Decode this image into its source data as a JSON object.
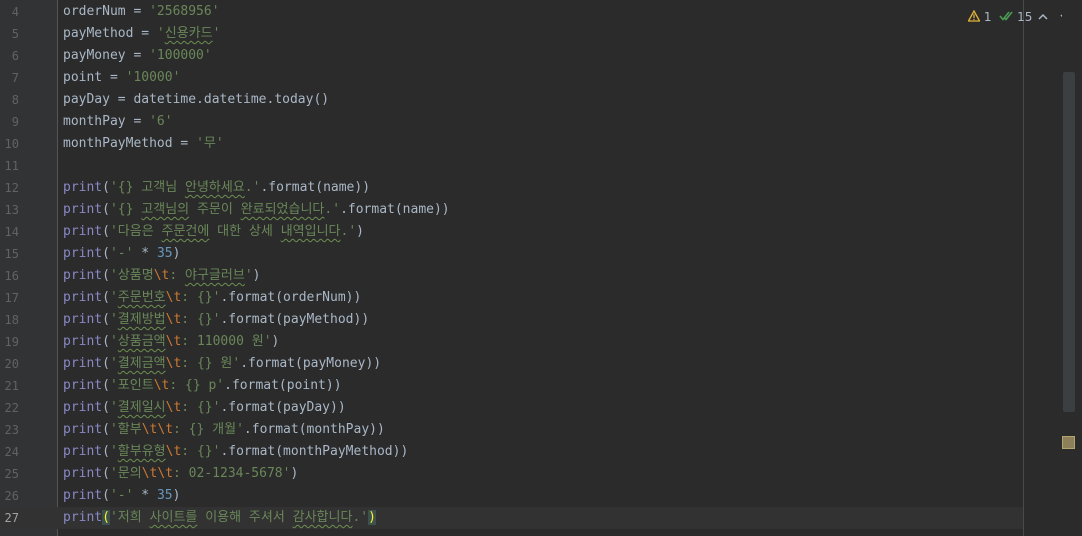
{
  "inspection": {
    "warnings_count": "1",
    "weak_warnings_count": "15",
    "prev_symbol": "⌃",
    "next_symbol": "⌄",
    "warning_color": "#e2b33a",
    "check_color": "#499c54"
  },
  "colors": {
    "background": "#2b2b2b",
    "gutter": "#313335",
    "string": "#6a8759",
    "escape": "#cc7832",
    "number": "#6897bb",
    "builtin": "#8888c6",
    "text": "#a9b7c6"
  },
  "current_line": "27",
  "lines": [
    {
      "no": "4",
      "tokens": [
        {
          "t": "orderNum = ",
          "c": ""
        },
        {
          "t": "'2568956'",
          "c": "t-str"
        }
      ]
    },
    {
      "no": "5",
      "tokens": [
        {
          "t": "payMethod = ",
          "c": ""
        },
        {
          "t": "'",
          "c": "t-str"
        },
        {
          "t": "신용카드",
          "c": "t-str squig"
        },
        {
          "t": "'",
          "c": "t-str"
        }
      ]
    },
    {
      "no": "6",
      "tokens": [
        {
          "t": "payMoney = ",
          "c": ""
        },
        {
          "t": "'100000'",
          "c": "t-str"
        }
      ]
    },
    {
      "no": "7",
      "tokens": [
        {
          "t": "point = ",
          "c": ""
        },
        {
          "t": "'10000'",
          "c": "t-str"
        }
      ]
    },
    {
      "no": "8",
      "tokens": [
        {
          "t": "payDay = datetime.datetime.today()",
          "c": ""
        }
      ]
    },
    {
      "no": "9",
      "tokens": [
        {
          "t": "monthPay = ",
          "c": ""
        },
        {
          "t": "'6'",
          "c": "t-str"
        }
      ]
    },
    {
      "no": "10",
      "tokens": [
        {
          "t": "monthPayMethod = ",
          "c": ""
        },
        {
          "t": "'무'",
          "c": "t-str"
        }
      ]
    },
    {
      "no": "11",
      "tokens": []
    },
    {
      "no": "12",
      "tokens": [
        {
          "t": "print",
          "c": "t-fn"
        },
        {
          "t": "(",
          "c": ""
        },
        {
          "t": "'{} 고객님 ",
          "c": "t-str"
        },
        {
          "t": "안녕하세요",
          "c": "t-str squig"
        },
        {
          "t": ".'",
          "c": "t-str"
        },
        {
          "t": ".format(name))",
          "c": ""
        }
      ]
    },
    {
      "no": "13",
      "tokens": [
        {
          "t": "print",
          "c": "t-fn"
        },
        {
          "t": "(",
          "c": ""
        },
        {
          "t": "'{} ",
          "c": "t-str"
        },
        {
          "t": "고객님의",
          "c": "t-str squig"
        },
        {
          "t": " 주문이 ",
          "c": "t-str"
        },
        {
          "t": "완료되었습니다",
          "c": "t-str squig"
        },
        {
          "t": ".'",
          "c": "t-str"
        },
        {
          "t": ".format(name))",
          "c": ""
        }
      ]
    },
    {
      "no": "14",
      "tokens": [
        {
          "t": "print",
          "c": "t-fn"
        },
        {
          "t": "(",
          "c": ""
        },
        {
          "t": "'다음은 ",
          "c": "t-str"
        },
        {
          "t": "주문건에",
          "c": "t-str squig"
        },
        {
          "t": " 대한 상세 ",
          "c": "t-str"
        },
        {
          "t": "내역입니다",
          "c": "t-str squig"
        },
        {
          "t": ".'",
          "c": "t-str"
        },
        {
          "t": ")",
          "c": ""
        }
      ]
    },
    {
      "no": "15",
      "tokens": [
        {
          "t": "print",
          "c": "t-fn"
        },
        {
          "t": "(",
          "c": ""
        },
        {
          "t": "'-'",
          "c": "t-str"
        },
        {
          "t": " * ",
          "c": ""
        },
        {
          "t": "35",
          "c": "t-num"
        },
        {
          "t": ")",
          "c": ""
        }
      ]
    },
    {
      "no": "16",
      "tokens": [
        {
          "t": "print",
          "c": "t-fn"
        },
        {
          "t": "(",
          "c": ""
        },
        {
          "t": "'상품명",
          "c": "t-str"
        },
        {
          "t": "\\t",
          "c": "t-esc"
        },
        {
          "t": ": ",
          "c": "t-str"
        },
        {
          "t": "야구글러브",
          "c": "t-str squig"
        },
        {
          "t": "'",
          "c": "t-str"
        },
        {
          "t": ")",
          "c": ""
        }
      ]
    },
    {
      "no": "17",
      "tokens": [
        {
          "t": "print",
          "c": "t-fn"
        },
        {
          "t": "(",
          "c": ""
        },
        {
          "t": "'",
          "c": "t-str"
        },
        {
          "t": "주문번호",
          "c": "t-str squig"
        },
        {
          "t": "\\t",
          "c": "t-esc"
        },
        {
          "t": ": {}'",
          "c": "t-str"
        },
        {
          "t": ".format(orderNum))",
          "c": ""
        }
      ]
    },
    {
      "no": "18",
      "tokens": [
        {
          "t": "print",
          "c": "t-fn"
        },
        {
          "t": "(",
          "c": ""
        },
        {
          "t": "'",
          "c": "t-str"
        },
        {
          "t": "결제방법",
          "c": "t-str squig"
        },
        {
          "t": "\\t",
          "c": "t-esc"
        },
        {
          "t": ": {}'",
          "c": "t-str"
        },
        {
          "t": ".format(payMethod))",
          "c": ""
        }
      ]
    },
    {
      "no": "19",
      "tokens": [
        {
          "t": "print",
          "c": "t-fn"
        },
        {
          "t": "(",
          "c": ""
        },
        {
          "t": "'",
          "c": "t-str"
        },
        {
          "t": "상품금액",
          "c": "t-str squig"
        },
        {
          "t": "\\t",
          "c": "t-esc"
        },
        {
          "t": ": 110000 원'",
          "c": "t-str"
        },
        {
          "t": ")",
          "c": ""
        }
      ]
    },
    {
      "no": "20",
      "tokens": [
        {
          "t": "print",
          "c": "t-fn"
        },
        {
          "t": "(",
          "c": ""
        },
        {
          "t": "'",
          "c": "t-str"
        },
        {
          "t": "결제금액",
          "c": "t-str squig"
        },
        {
          "t": "\\t",
          "c": "t-esc"
        },
        {
          "t": ": {} 원'",
          "c": "t-str"
        },
        {
          "t": ".format(payMoney))",
          "c": ""
        }
      ]
    },
    {
      "no": "21",
      "tokens": [
        {
          "t": "print",
          "c": "t-fn"
        },
        {
          "t": "(",
          "c": ""
        },
        {
          "t": "'포인트",
          "c": "t-str"
        },
        {
          "t": "\\t",
          "c": "t-esc"
        },
        {
          "t": ": {} p'",
          "c": "t-str"
        },
        {
          "t": ".format(point))",
          "c": ""
        }
      ]
    },
    {
      "no": "22",
      "tokens": [
        {
          "t": "print",
          "c": "t-fn"
        },
        {
          "t": "(",
          "c": ""
        },
        {
          "t": "'",
          "c": "t-str"
        },
        {
          "t": "결제일시",
          "c": "t-str squig"
        },
        {
          "t": "\\t",
          "c": "t-esc"
        },
        {
          "t": ": {}'",
          "c": "t-str"
        },
        {
          "t": ".format(payDay))",
          "c": ""
        }
      ]
    },
    {
      "no": "23",
      "tokens": [
        {
          "t": "print",
          "c": "t-fn"
        },
        {
          "t": "(",
          "c": ""
        },
        {
          "t": "'할부",
          "c": "t-str"
        },
        {
          "t": "\\t\\t",
          "c": "t-esc"
        },
        {
          "t": ": {} 개월'",
          "c": "t-str"
        },
        {
          "t": ".format(monthPay))",
          "c": ""
        }
      ]
    },
    {
      "no": "24",
      "tokens": [
        {
          "t": "print",
          "c": "t-fn"
        },
        {
          "t": "(",
          "c": ""
        },
        {
          "t": "'",
          "c": "t-str"
        },
        {
          "t": "할부유형",
          "c": "t-str squig"
        },
        {
          "t": "\\t",
          "c": "t-esc"
        },
        {
          "t": ": {}'",
          "c": "t-str"
        },
        {
          "t": ".format(monthPayMethod))",
          "c": ""
        }
      ]
    },
    {
      "no": "25",
      "tokens": [
        {
          "t": "print",
          "c": "t-fn"
        },
        {
          "t": "(",
          "c": ""
        },
        {
          "t": "'문의",
          "c": "t-str"
        },
        {
          "t": "\\t\\t",
          "c": "t-esc"
        },
        {
          "t": ": 02-1234-5678'",
          "c": "t-str"
        },
        {
          "t": ")",
          "c": ""
        }
      ]
    },
    {
      "no": "26",
      "tokens": [
        {
          "t": "print",
          "c": "t-fn"
        },
        {
          "t": "(",
          "c": ""
        },
        {
          "t": "'-'",
          "c": "t-str"
        },
        {
          "t": " * ",
          "c": ""
        },
        {
          "t": "35",
          "c": "t-num"
        },
        {
          "t": ")",
          "c": ""
        }
      ]
    },
    {
      "no": "27",
      "tokens": [
        {
          "t": "print",
          "c": "t-fn"
        },
        {
          "t": "(",
          "c": "t-brm"
        },
        {
          "t": "'저희 ",
          "c": "t-str"
        },
        {
          "t": "사이트를",
          "c": "t-str squig"
        },
        {
          "t": " 이용해 주셔서 ",
          "c": "t-str"
        },
        {
          "t": "감사합니다",
          "c": "t-str squig"
        },
        {
          "t": ".'",
          "c": "t-str"
        },
        {
          "t": ")",
          "c": "t-brm"
        }
      ]
    }
  ]
}
